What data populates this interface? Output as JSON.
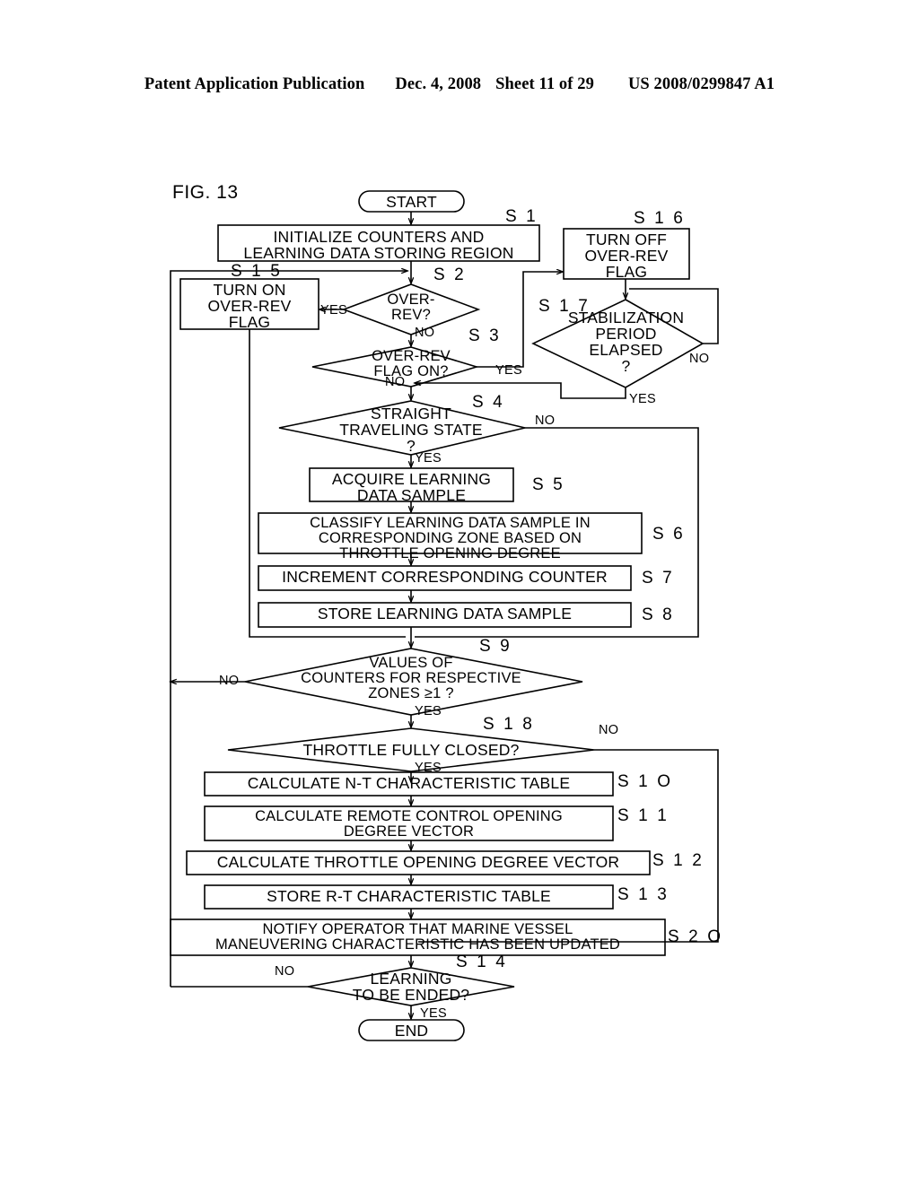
{
  "header": {
    "publication": "Patent Application Publication",
    "date": "Dec. 4, 2008",
    "sheet": "Sheet 11 of 29",
    "patent_number": "US 2008/0299847 A1"
  },
  "figure": {
    "label": "FIG. 13",
    "terminals": {
      "start": "START",
      "end": "END"
    },
    "steps": [
      {
        "id": "S1",
        "ref": "S 1",
        "type": "process",
        "text": "INITIALIZE COUNTERS AND\nLEARNING DATA STORING REGION"
      },
      {
        "id": "S2",
        "ref": "S 2",
        "type": "decision",
        "text": "OVER-\nREV?"
      },
      {
        "id": "S3",
        "ref": "S 3",
        "type": "decision",
        "text": "OVER-REV\nFLAG ON?"
      },
      {
        "id": "S4",
        "ref": "S 4",
        "type": "decision",
        "text": "STRAIGHT\nTRAVELING STATE\n?"
      },
      {
        "id": "S5",
        "ref": "S 5",
        "type": "process",
        "text": "ACQUIRE LEARNING\nDATA SAMPLE"
      },
      {
        "id": "S6",
        "ref": "S 6",
        "type": "process",
        "text": "CLASSIFY LEARNING DATA SAMPLE IN\nCORRESPONDING ZONE BASED ON\nTHROTTLE OPENING DEGREE"
      },
      {
        "id": "S7",
        "ref": "S 7",
        "type": "process",
        "text": "INCREMENT CORRESPONDING COUNTER"
      },
      {
        "id": "S8",
        "ref": "S 8",
        "type": "process",
        "text": "STORE LEARNING DATA SAMPLE"
      },
      {
        "id": "S9",
        "ref": "S 9",
        "type": "decision",
        "text": "VALUES OF\nCOUNTERS FOR RESPECTIVE\nZONES  ≥1 ?"
      },
      {
        "id": "S10",
        "ref": "S 1 O",
        "type": "process",
        "text": "CALCULATE N-T CHARACTERISTIC TABLE"
      },
      {
        "id": "S11",
        "ref": "S 1 1",
        "type": "process",
        "text": "CALCULATE REMOTE CONTROL OPENING\nDEGREE VECTOR"
      },
      {
        "id": "S12",
        "ref": "S 1 2",
        "type": "process",
        "text": "CALCULATE THROTTLE OPENING DEGREE VECTOR"
      },
      {
        "id": "S13",
        "ref": "S 1 3",
        "type": "process",
        "text": "STORE R-T CHARACTERISTIC TABLE"
      },
      {
        "id": "S14",
        "ref": "S 1 4",
        "type": "decision",
        "text": "LEARNING\nTO BE ENDED?"
      },
      {
        "id": "S15",
        "ref": "S 1 5",
        "type": "process",
        "text": "TURN ON\nOVER-REV\nFLAG"
      },
      {
        "id": "S16",
        "ref": "S 1 6",
        "type": "process",
        "text": "TURN OFF\nOVER-REV\nFLAG"
      },
      {
        "id": "S17",
        "ref": "S 1 7",
        "type": "decision",
        "text": "STABILIZATION\nPERIOD\nELAPSED\n?"
      },
      {
        "id": "S18",
        "ref": "S 1 8",
        "type": "decision",
        "text": "THROTTLE FULLY CLOSED?"
      },
      {
        "id": "S20",
        "ref": "S 2 O",
        "type": "process",
        "text": "NOTIFY OPERATOR THAT MARINE VESSEL\nMANEUVERING CHARACTERISTIC HAS BEEN UPDATED"
      }
    ],
    "branches": [
      {
        "from": "S2",
        "label": "YES"
      },
      {
        "from": "S2",
        "label": "NO"
      },
      {
        "from": "S3",
        "label": "YES"
      },
      {
        "from": "S3",
        "label": "NO"
      },
      {
        "from": "S4",
        "label": "NO"
      },
      {
        "from": "S4",
        "label": "YES"
      },
      {
        "from": "S9",
        "label": "NO"
      },
      {
        "from": "S9",
        "label": "YES"
      },
      {
        "from": "S17",
        "label": "NO"
      },
      {
        "from": "S17",
        "label": "YES"
      },
      {
        "from": "S18",
        "label": "NO"
      },
      {
        "from": "S18",
        "label": "YES"
      },
      {
        "from": "S14",
        "label": "NO"
      },
      {
        "from": "S14",
        "label": "YES"
      }
    ],
    "colors": {
      "ink": "#000000",
      "paper": "#ffffff"
    }
  }
}
